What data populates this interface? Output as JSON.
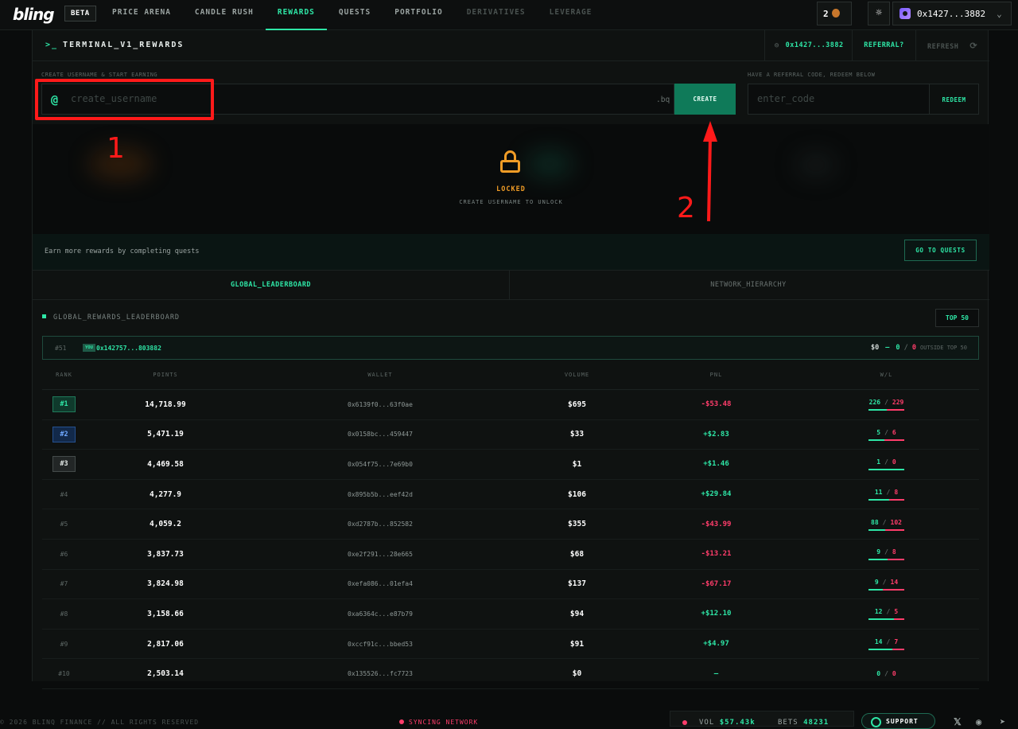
{
  "nav": {
    "logo": "bling",
    "beta": "BETA",
    "links": [
      "PRICE ARENA",
      "CANDLE RUSH",
      "REWARDS",
      "QUESTS",
      "PORTFOLIO",
      "DERIVATIVES",
      "LEVERAGE"
    ],
    "count": "2",
    "wallet": "0x1427...3882"
  },
  "panel": {
    "title": "TERMINAL_V1_REWARDS",
    "wallet_short": "0x1427...3882",
    "referral": "REFERRAL?",
    "refresh": "REFRESH"
  },
  "create": {
    "label": "CREATE USERNAME & START EARNING",
    "at": "@",
    "placeholder": "create_username",
    "suffix": ".bq",
    "button": "CREATE"
  },
  "redeem": {
    "label": "HAVE A REFERRAL CODE, REDEEM BELOW",
    "placeholder": "enter_code",
    "button": "REDEEM"
  },
  "locked": {
    "title": "LOCKED",
    "subtitle": "CREATE USERNAME TO UNLOCK"
  },
  "quests": {
    "text": "Earn more rewards by completing quests",
    "button": "GO TO QUESTS"
  },
  "tabs": [
    "GLOBAL_LEADERBOARD",
    "NETWORK_HIERARCHY"
  ],
  "leaderboard": {
    "title": "GLOBAL_REWARDS_LEADERBOARD",
    "filter": "TOP 50",
    "you": {
      "rank": "#51",
      "tag": "YOU",
      "address": "0x142757...803882",
      "volume": "$0",
      "dash": "–",
      "wins": "0",
      "slash": "/",
      "losses": "0",
      "note": "OUTSIDE TOP 50"
    },
    "columns": [
      "RANK",
      "POINTS",
      "WALLET",
      "VOLUME",
      "PNL",
      "W/L"
    ],
    "rows": [
      {
        "rank": "#1",
        "points": "14,718.99",
        "wallet": "0x6139f0...63f0ae",
        "volume": "$695",
        "pnl": "-$53.48",
        "w": "226",
        "l": "229",
        "ratio": 0.5
      },
      {
        "rank": "#2",
        "points": "5,471.19",
        "wallet": "0x0158bc...459447",
        "volume": "$33",
        "pnl": "+$2.83",
        "w": "5",
        "l": "6",
        "ratio": 0.45
      },
      {
        "rank": "#3",
        "points": "4,469.58",
        "wallet": "0x054f75...7e69b0",
        "volume": "$1",
        "pnl": "+$1.46",
        "w": "1",
        "l": "0",
        "ratio": 1.0
      },
      {
        "rank": "#4",
        "points": "4,277.9",
        "wallet": "0x895b5b...eef42d",
        "volume": "$106",
        "pnl": "+$29.84",
        "w": "11",
        "l": "8",
        "ratio": 0.58
      },
      {
        "rank": "#5",
        "points": "4,059.2",
        "wallet": "0xd2787b...852582",
        "volume": "$355",
        "pnl": "-$43.99",
        "w": "88",
        "l": "102",
        "ratio": 0.46
      },
      {
        "rank": "#6",
        "points": "3,837.73",
        "wallet": "0xe2f291...28e665",
        "volume": "$68",
        "pnl": "-$13.21",
        "w": "9",
        "l": "8",
        "ratio": 0.53
      },
      {
        "rank": "#7",
        "points": "3,824.98",
        "wallet": "0xefa086...01efa4",
        "volume": "$137",
        "pnl": "-$67.17",
        "w": "9",
        "l": "14",
        "ratio": 0.39
      },
      {
        "rank": "#8",
        "points": "3,158.66",
        "wallet": "0xa6364c...e87b79",
        "volume": "$94",
        "pnl": "+$12.10",
        "w": "12",
        "l": "5",
        "ratio": 0.71
      },
      {
        "rank": "#9",
        "points": "2,817.06",
        "wallet": "0xccf91c...bbed53",
        "volume": "$91",
        "pnl": "+$4.97",
        "w": "14",
        "l": "7",
        "ratio": 0.67
      },
      {
        "rank": "#10",
        "points": "2,503.14",
        "wallet": "0x135526...fc7723",
        "volume": "$0",
        "pnl": "–",
        "w": "0",
        "l": "0",
        "ratio": null
      }
    ]
  },
  "footer": {
    "copyright": "© 2026 BLINQ FINANCE // ALL RIGHTS RESERVED",
    "status": "SYNCING NETWORK",
    "vol_label": "VOL",
    "vol": "$57.43k",
    "bets_label": "BETS",
    "bets": "48231",
    "support": "SUPPORT"
  },
  "annotations": {
    "one": "1",
    "two": "2"
  },
  "colors": {
    "accent": "#2ee6a6",
    "negative": "#ff3d6b",
    "locked": "#f09c26",
    "annotation": "#ff1a1a"
  }
}
